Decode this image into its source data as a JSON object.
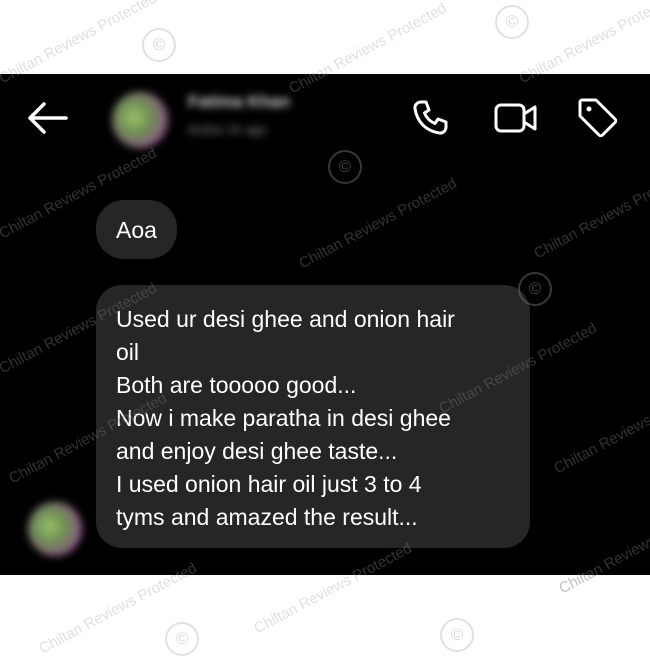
{
  "header": {
    "contact_name": "Fatima Khan",
    "contact_status": "Active 1h ago",
    "icons": [
      "back-arrow-icon",
      "phone-icon",
      "video-camera-icon",
      "tag-icon"
    ]
  },
  "messages": [
    {
      "lines": [
        "Aoa"
      ]
    },
    {
      "lines": [
        "Used ur desi ghee and onion hair",
        "oil",
        "Both are tooooo good...",
        "Now i make paratha in desi ghee",
        "and enjoy desi ghee taste...",
        "I used onion hair oil just 3 to 4",
        "tyms and amazed the result..."
      ]
    }
  ],
  "watermark": {
    "text": "Chiltan Reviews Protected",
    "symbol": "©"
  },
  "colors": {
    "background": "#000000",
    "bubble": "#262626",
    "text": "#ffffff",
    "page": "#ffffff"
  }
}
